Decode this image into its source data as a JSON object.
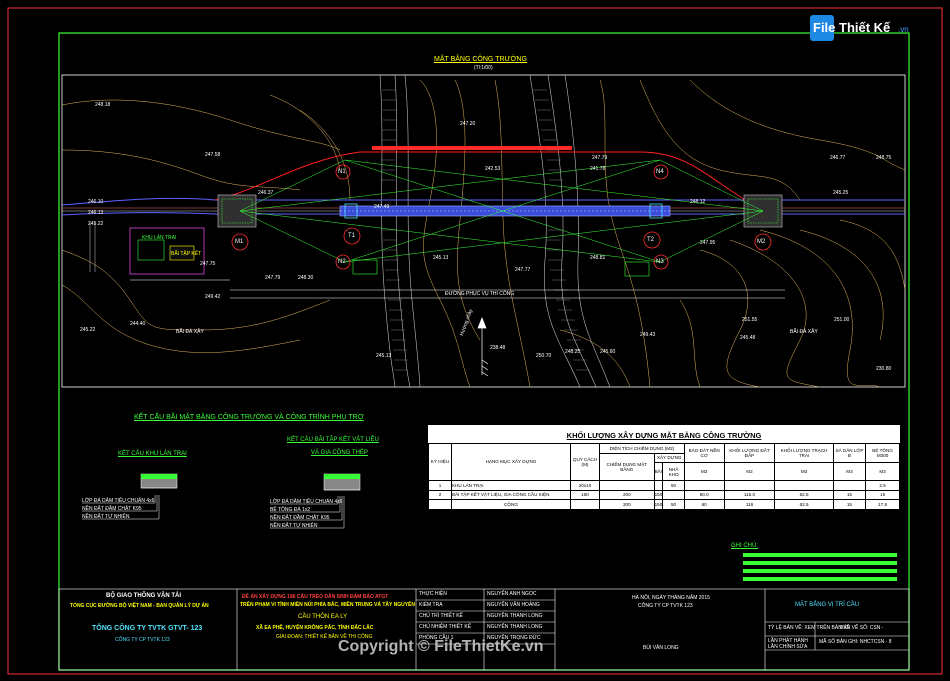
{
  "logo": {
    "brand": "File Thiết Kế",
    "suffix": ".vn"
  },
  "drawing_title": {
    "main": "MẶT BẰNG CÔNG TRƯỜNG",
    "scale": "(Tl:1/00)"
  },
  "piers": {
    "m1": "M1",
    "m2": "M2",
    "t1": "T1",
    "t2": "T2",
    "n1": "N1",
    "n2": "N2",
    "n3": "N3",
    "n4": "N4"
  },
  "elevations": [
    "248.18",
    "247.58",
    "246.13",
    "246.10",
    "245.22",
    "246.37",
    "247.75",
    "247.79",
    "248.30",
    "249.42",
    "244.40",
    "245.22",
    "247.20",
    "247.79",
    "242.53",
    "241.78",
    "245.13",
    "247.77",
    "248.81",
    "246.77",
    "248.75",
    "247.95",
    "245.25",
    "248.12",
    "248.25",
    "249.43",
    "245.48",
    "251.55",
    "251.00",
    "230.80",
    "247.49",
    "238.48",
    "245.13",
    "245.60",
    "250.70"
  ],
  "site_labels": {
    "gravel_stock": "BÃI ĐÁ XÂY",
    "camp": "KHU LÁN TRẠI",
    "storage": "BÃI TẬP KẾT",
    "work_road": "ĐƯỜNG PHỤC VỤ THI CÔNG",
    "north": "Hướng chảy",
    "gravel_stock_2": "BÃI ĐÁ XÂY"
  },
  "structure_section": {
    "title": "KẾT CẤU BÃI MẶT BẰNG CÔNG TRƯỜNG VÀ CÔNG TRÌNH PHỤ TRỢ",
    "camp_title": "KẾT CẤU KHU LÁN TRẠI",
    "camp_layers": [
      "LỚP ĐÁ DĂM TIÊU CHUẨN 4x6",
      "NỀN ĐẤT ĐẦM CHẶT K95",
      "NỀN ĐẤT TỰ NHIÊN"
    ],
    "yard_title_1": "KẾT CẤU BÃI TẬP KẾT VẬT LIỆU",
    "yard_title_2": "VÀ GIA CÔNG THÉP",
    "yard_layers": [
      "LỚP ĐÁ DĂM TIÊU CHUẨN 4x6",
      "BÊ TÔNG ĐÁ 1x2",
      "NỀN ĐẤT ĐẦM CHẶT K95",
      "NỀN ĐẤT TỰ NHIÊN"
    ]
  },
  "qty_table": {
    "title": "KHỐI LƯỢNG XÂY DỰNG MẶT BẰNG CÔNG TRƯỜNG",
    "headers": {
      "no": "KÝ HIỆU",
      "item": "HẠNG MỤC XÂY DỰNG",
      "size": "QUY CÁCH (M)",
      "area_group": "DIỆN TÍCH CHIẾM DỤNG (M2)",
      "occupied": "CHIẾM DỤNG MẶT BẰNG",
      "build_group": "XÂY DỰNG",
      "yard": "BÃI",
      "warehouse": "NHÀ KHO",
      "gravel": "BÁO ĐÁT NỀN CƠ",
      "hardcore": "KHỐI LƯỢNG ĐẤT ĐẮP",
      "gravel_layer": "KHỐI LƯỢNG TRẠCH TRẢI",
      "sand": "SÁ DĂN LỚP B",
      "concrete": "BÊ TÔNG M300"
    },
    "units": [
      "M2",
      "M2",
      "M3",
      "M3",
      "M3"
    ],
    "rows": [
      {
        "no": "1",
        "item": "KHU LÁN TRẠI",
        "size": "20x10",
        "occupied": "",
        "yard": "",
        "warehouse": "50",
        "gravel": "",
        "hardcore": "",
        "layer": "",
        "sand": "",
        "concrete": "2.5"
      },
      {
        "no": "2",
        "item": "BÃI TẬP KẾT VẬT LIỆU, GIA CÔNG CẦU KIỆN",
        "size": "150",
        "occupied": "200",
        "yard": "150",
        "warehouse": "",
        "gravel": "60.0",
        "hardcore": "116.0",
        "layer": "62.5",
        "sand": "15",
        "concrete": "15"
      },
      {
        "no": "",
        "item": "CỘNG",
        "size": "",
        "occupied": "200",
        "yard": "150",
        "warehouse": "50",
        "gravel": "60",
        "hardcore": "116",
        "layer": "62.5",
        "sand": "15",
        "concrete": "17.5"
      }
    ]
  },
  "notes": {
    "title": "GHI CHÚ:"
  },
  "title_block": {
    "ministry": "BỘ GIAO THÔNG VẬN TẢI",
    "dept": "TỔNG CỤC ĐƯỜNG BỘ VIỆT NAM - BAN QUẢN LÝ DỰ ÁN",
    "company": "TỔNG CÔNG TY TVTK GTVT- 123",
    "sub_company": "CÔNG TY CP TVTK 123",
    "project_1": "ĐỀ ÁN XÂY DỰNG 186 CẦU TREO DÂN SINH ĐẢM BẢO ATGT",
    "project_2": "TRÊN PHẠM VI TỈNH MIỀN NÚI PHÍA BẮC, MIỀN TRUNG VÀ TÂY NGUYÊN",
    "bridge": "CẦU THÔN EA LY",
    "location": "XÃ EA PHÊ, HUYỆN KRÔNG PẮC, TỈNH ĐẮC LẮC",
    "phase": "GIAI ĐOẠN: THIẾT KẾ BẢN VẼ THI CÔNG",
    "roles": [
      "THỰC HIỆN",
      "KIỂM TRA",
      "CHỦ TRÌ THIẾT KẾ",
      "CHỦ NHIỆM THIẾT KẾ",
      "PHÒNG CẦU 1"
    ],
    "names": [
      "NGUYỄN ANH NGỌC",
      "NGUYỄN VĂN HOÀNG",
      "NGUYỄN THANH LONG",
      "NGUYỄN THANH LONG",
      "NGUYỄN TRỌNG ĐỨC"
    ],
    "date": "HÀ NỘI, NGÀY      THÁNG      NĂM 2015",
    "approver_company": "CÔNG TY CP TVTK 123",
    "director": "BÙI VĂN LONG",
    "sheet_title": "MẶT BẰNG VỊ TRÍ CẦU",
    "scale_line": "TỶ LỆ BẢN VẼ: XEM TRÊN BẢN VẼ",
    "sheet_no": "BẢN VẼ SỐ:   CSN -",
    "rev_1": "LẦN PHÁT HÀNH",
    "rev_2": "LẦN CHỈNH SỬA",
    "file_code": "MÃ SỐ BẢN GHI: NHCTCSN - 8"
  },
  "watermark": "Copyright © FileThietKe.vn"
}
